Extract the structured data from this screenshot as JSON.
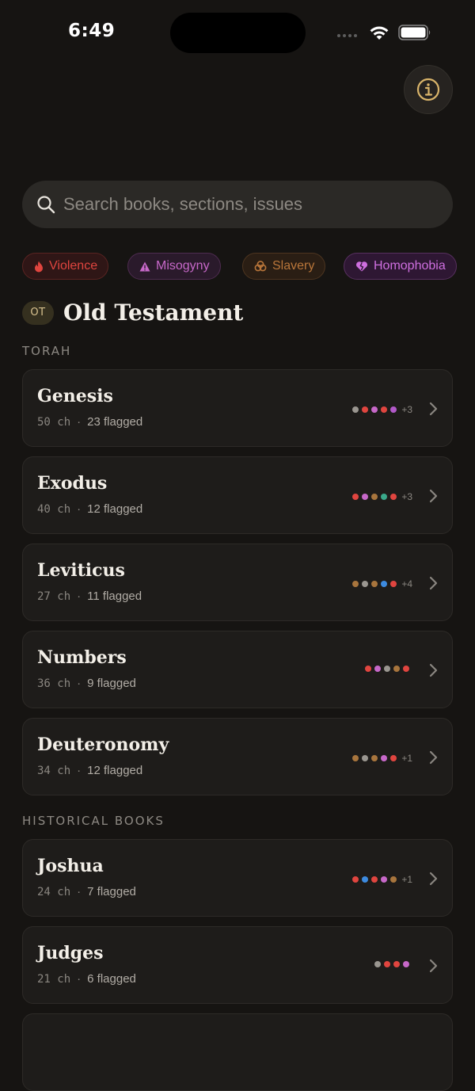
{
  "status_bar": {
    "time": "6:49"
  },
  "search": {
    "placeholder": "Search books, sections, issues"
  },
  "chips": [
    {
      "label": "Violence",
      "icon": "flame-icon",
      "color": "#e0453f",
      "bg": "#2f1616",
      "border": "#5a2422"
    },
    {
      "label": "Misogyny",
      "icon": "warning-triangle-icon",
      "color": "#c768c9",
      "bg": "#2a1a2b",
      "border": "#4e2c50"
    },
    {
      "label": "Slavery",
      "icon": "chain-link-icon",
      "color": "#b9763a",
      "bg": "#2a1e14",
      "border": "#4d3520"
    },
    {
      "label": "Homophobia",
      "icon": "broken-heart-icon",
      "color": "#cf6fe0",
      "bg": "#2e1733",
      "border": "#57305f"
    }
  ],
  "section": {
    "badge": "OT",
    "title": "Old Testament"
  },
  "groups": [
    {
      "label": "TORAH"
    },
    {
      "label": "HISTORICAL BOOKS"
    }
  ],
  "books": [
    {
      "name": "Genesis",
      "chapters": "50",
      "ch_label": "ch",
      "flagged": "23 flagged",
      "dots": [
        "#9a9690",
        "#e0453f",
        "#c768c9",
        "#e0453f",
        "#b259c9"
      ],
      "more": "+3"
    },
    {
      "name": "Exodus",
      "chapters": "40",
      "ch_label": "ch",
      "flagged": "12 flagged",
      "dots": [
        "#e0453f",
        "#c768c9",
        "#a8753d",
        "#3aa88a",
        "#e0453f"
      ],
      "more": "+3"
    },
    {
      "name": "Leviticus",
      "chapters": "27",
      "ch_label": "ch",
      "flagged": "11 flagged",
      "dots": [
        "#a8753d",
        "#9a9690",
        "#a8753d",
        "#3d8be0",
        "#e0453f"
      ],
      "more": "+4"
    },
    {
      "name": "Numbers",
      "chapters": "36",
      "ch_label": "ch",
      "flagged": "9 flagged",
      "dots": [
        "#e0453f",
        "#c768c9",
        "#9a9690",
        "#a8753d",
        "#e0453f"
      ],
      "more": ""
    },
    {
      "name": "Deuteronomy",
      "chapters": "34",
      "ch_label": "ch",
      "flagged": "12 flagged",
      "dots": [
        "#a8753d",
        "#9a9690",
        "#a8753d",
        "#c768c9",
        "#e0453f"
      ],
      "more": "+1"
    },
    {
      "name": "Joshua",
      "chapters": "24",
      "ch_label": "ch",
      "flagged": "7 flagged",
      "dots": [
        "#e0453f",
        "#3d8be0",
        "#e0453f",
        "#c768c9",
        "#a8753d"
      ],
      "more": "+1"
    },
    {
      "name": "Judges",
      "chapters": "21",
      "ch_label": "ch",
      "flagged": "6 flagged",
      "dots": [
        "#9a9690",
        "#e0453f",
        "#e0453f",
        "#c768c9"
      ],
      "more": ""
    }
  ]
}
